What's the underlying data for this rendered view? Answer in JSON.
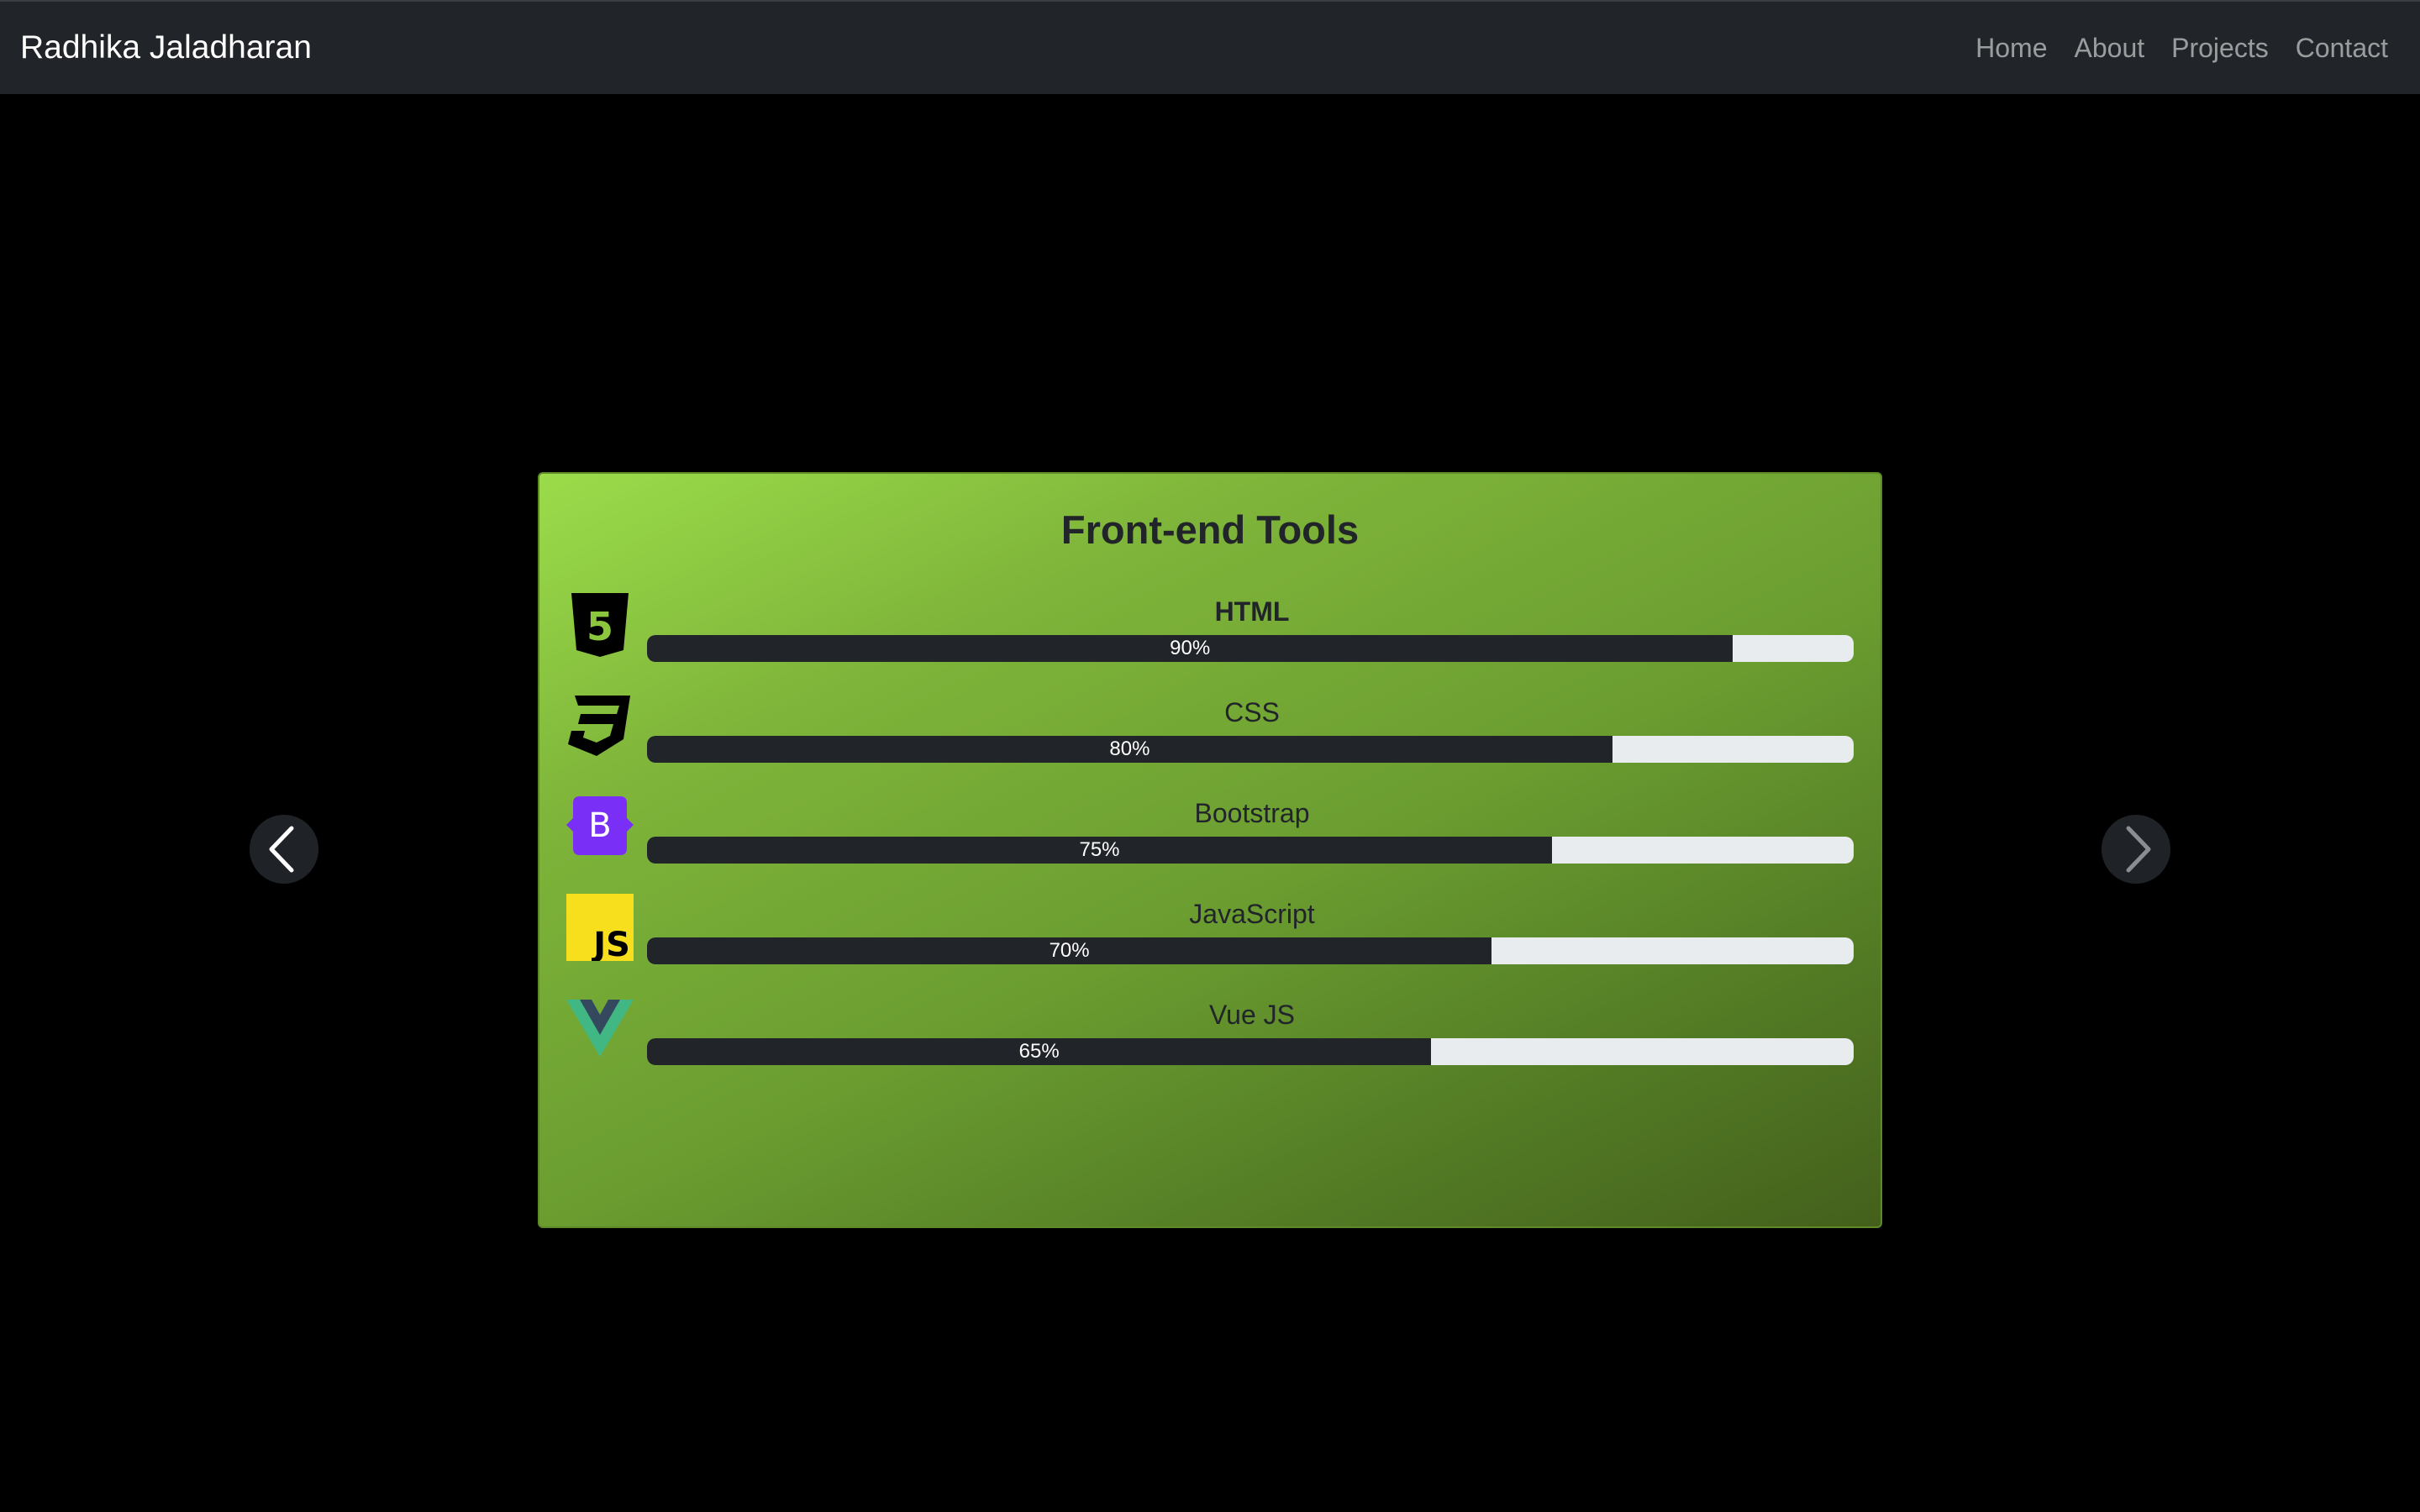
{
  "navbar": {
    "brand": "Radhika Jaladharan",
    "links": [
      "Home",
      "About",
      "Projects",
      "Contact"
    ]
  },
  "carousel": {
    "prev_icon": "chevron-left-icon",
    "next_icon": "chevron-right-icon"
  },
  "card": {
    "title": "Front-end Tools",
    "skills": [
      {
        "name": "HTML",
        "percent_label": "90%",
        "percent": 90,
        "icon": "html5-icon"
      },
      {
        "name": "CSS",
        "percent_label": "80%",
        "percent": 80,
        "icon": "css3-icon"
      },
      {
        "name": "Bootstrap",
        "percent_label": "75%",
        "percent": 75,
        "icon": "bootstrap-icon"
      },
      {
        "name": "JavaScript",
        "percent_label": "70%",
        "percent": 70,
        "icon": "javascript-icon"
      },
      {
        "name": "Vue JS",
        "percent_label": "65%",
        "percent": 65,
        "icon": "vuejs-icon"
      }
    ]
  },
  "colors": {
    "navbar_bg": "#212529",
    "progress_fill": "#212529",
    "progress_track": "#e9ecef",
    "card_gradient_start": "#9bdc4a",
    "card_gradient_end": "#44601c",
    "bootstrap_purple": "#7a2ff7",
    "js_yellow": "#f7df1e",
    "vue_green": "#41b883",
    "vue_dark": "#35495e"
  },
  "icon_texts": {
    "html5": "5",
    "bootstrap": "B",
    "javascript": "JS"
  }
}
